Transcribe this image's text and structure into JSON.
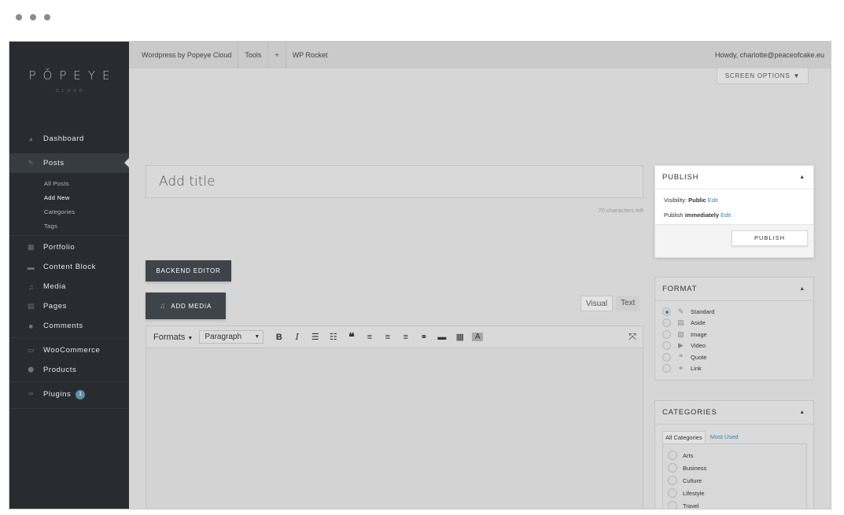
{
  "brand": {
    "name": "PǑPEYE",
    "sub": "CLOUD"
  },
  "sidebar": {
    "items": [
      {
        "label": "Dashboard",
        "icon": "dashboard-icon"
      },
      {
        "label": "Posts",
        "icon": "pin-icon"
      },
      {
        "label": "Portfolio",
        "icon": "grid-icon"
      },
      {
        "label": "Content Block",
        "icon": "block-icon"
      },
      {
        "label": "Media",
        "icon": "media-icon"
      },
      {
        "label": "Pages",
        "icon": "pages-icon"
      },
      {
        "label": "Comments",
        "icon": "comment-icon"
      },
      {
        "label": "WooCommerce",
        "icon": "woo-icon"
      },
      {
        "label": "Products",
        "icon": "box-icon"
      },
      {
        "label": "Plugins",
        "icon": "plug-icon"
      }
    ],
    "submenu": [
      "All Posts",
      "Add New",
      "Categories",
      "Tags"
    ],
    "plugins_badge": "1"
  },
  "topbar": {
    "site": "Wordpress by Popeye Cloud",
    "tools": "Tools",
    "plus": "+",
    "rocket": "WP Rocket",
    "howdy": "Howdy, charlotte@peaceofcake.eu"
  },
  "screen_options": "SCREEN OPTIONS",
  "editor": {
    "title_placeholder": "Add title",
    "char_count": "70 characters left",
    "backend_editor": "BACKEND EDITOR",
    "add_media": "ADD MEDIA",
    "tab_visual": "Visual",
    "tab_text": "Text",
    "formats": "Formats",
    "paragraph": "Paragraph"
  },
  "publish": {
    "heading": "PUBLISH",
    "visibility_label": "Visibility:",
    "visibility_value": "Public",
    "edit": "Edit",
    "publish_label": "Publish",
    "publish_value": "immediately",
    "button": "PUBLISH"
  },
  "format": {
    "heading": "FORMAT",
    "options": [
      "Standard",
      "Aside",
      "Image",
      "Video",
      "Quote",
      "Link"
    ],
    "selected": "Standard"
  },
  "categories": {
    "heading": "CATEGORIES",
    "tab_all": "All Categories",
    "tab_used": "Most Used",
    "items": [
      "Arts",
      "Business",
      "Culture",
      "Lifestyle",
      "Travel"
    ]
  },
  "colors": {
    "sidebar": "#282c31",
    "accent": "#3a83b3",
    "button_dark": "#3e444a"
  }
}
